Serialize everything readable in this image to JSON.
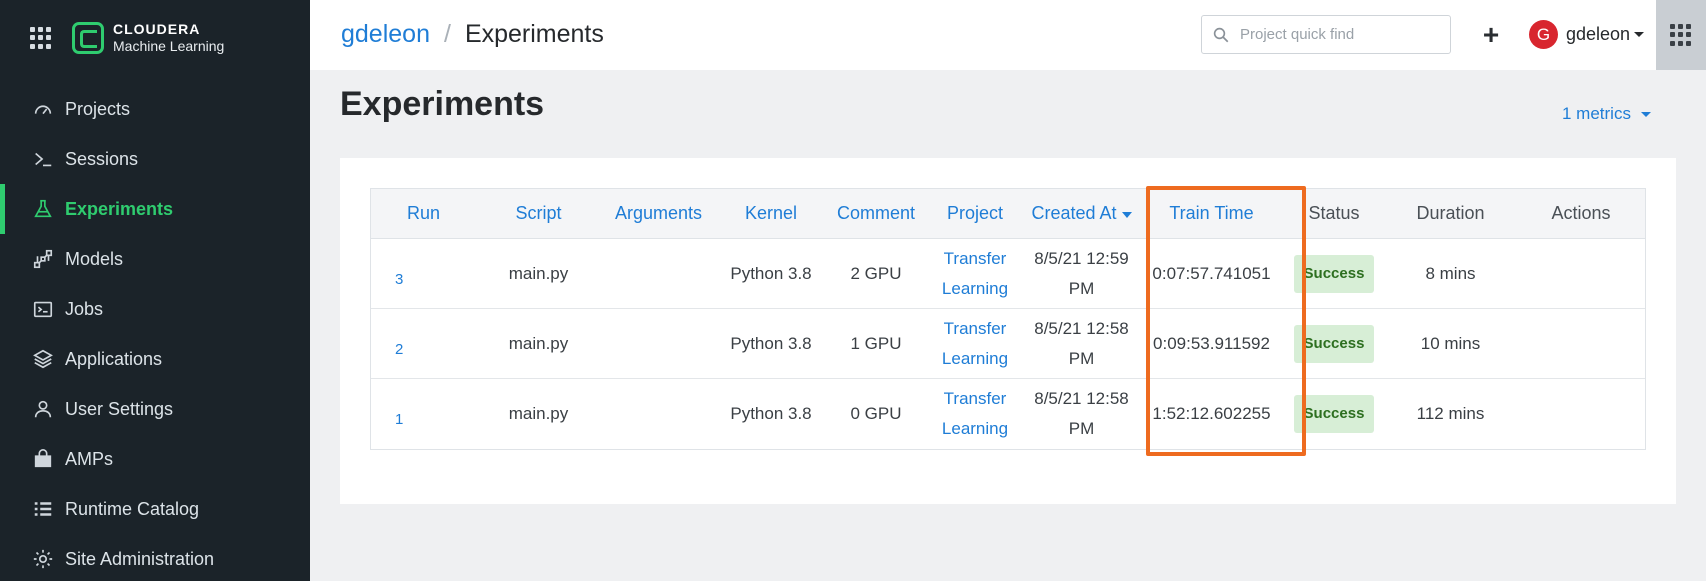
{
  "brand": {
    "title": "CLOUDERA",
    "subtitle": "Machine Learning"
  },
  "sidebar": {
    "items": [
      {
        "label": "Projects",
        "icon": "dashboard-gauge-icon",
        "active": false
      },
      {
        "label": "Sessions",
        "icon": "terminal-prompt-icon",
        "active": false
      },
      {
        "label": "Experiments",
        "icon": "flask-icon",
        "active": true
      },
      {
        "label": "Models",
        "icon": "model-nodes-icon",
        "active": false
      },
      {
        "label": "Jobs",
        "icon": "job-terminal-icon",
        "active": false
      },
      {
        "label": "Applications",
        "icon": "layers-icon",
        "active": false
      },
      {
        "label": "User Settings",
        "icon": "user-icon",
        "active": false
      },
      {
        "label": "AMPs",
        "icon": "shopping-bag-icon",
        "active": false
      },
      {
        "label": "Runtime Catalog",
        "icon": "list-icon",
        "active": false
      },
      {
        "label": "Site Administration",
        "icon": "gear-icon",
        "active": false
      }
    ]
  },
  "header": {
    "breadcrumb_user": "gdeleon",
    "breadcrumb_sep": "/",
    "breadcrumb_current": "Experiments",
    "search_placeholder": "Project quick find",
    "add_label": "+",
    "avatar_letter": "G",
    "username": "gdeleon"
  },
  "main": {
    "title": "Experiments",
    "metrics_label": "1 metrics"
  },
  "table": {
    "columns": {
      "run": "Run",
      "script": "Script",
      "arguments": "Arguments",
      "kernel": "Kernel",
      "comment": "Comment",
      "project": "Project",
      "created_at": "Created At",
      "train_time": "Train Time",
      "status": "Status",
      "duration": "Duration",
      "actions": "Actions"
    },
    "rows": [
      {
        "run": "3",
        "script": "main.py",
        "arguments": "",
        "kernel": "Python 3.8",
        "comment": "2 GPU",
        "project_l1": "Transfer",
        "project_l2": "Learning",
        "created_l1": "8/5/21 12:59",
        "created_l2": "PM",
        "train_time": "0:07:57.741051",
        "status": "Success",
        "duration": "8 mins"
      },
      {
        "run": "2",
        "script": "main.py",
        "arguments": "",
        "kernel": "Python 3.8",
        "comment": "1 GPU",
        "project_l1": "Transfer",
        "project_l2": "Learning",
        "created_l1": "8/5/21 12:58",
        "created_l2": "PM",
        "train_time": "0:09:53.911592",
        "status": "Success",
        "duration": "10 mins"
      },
      {
        "run": "1",
        "script": "main.py",
        "arguments": "",
        "kernel": "Python 3.8",
        "comment": "0 GPU",
        "project_l1": "Transfer",
        "project_l2": "Learning",
        "created_l1": "8/5/21 12:58",
        "created_l2": "PM",
        "train_time": "1:52:12.602255",
        "status": "Success",
        "duration": "112 mins"
      }
    ]
  },
  "colors": {
    "sidebar_bg": "#1b2329",
    "accent_green": "#2fcc6f",
    "link_blue": "#1f7dd6",
    "highlight_orange": "#ee6b1f",
    "success_bg": "#d7eed6"
  }
}
